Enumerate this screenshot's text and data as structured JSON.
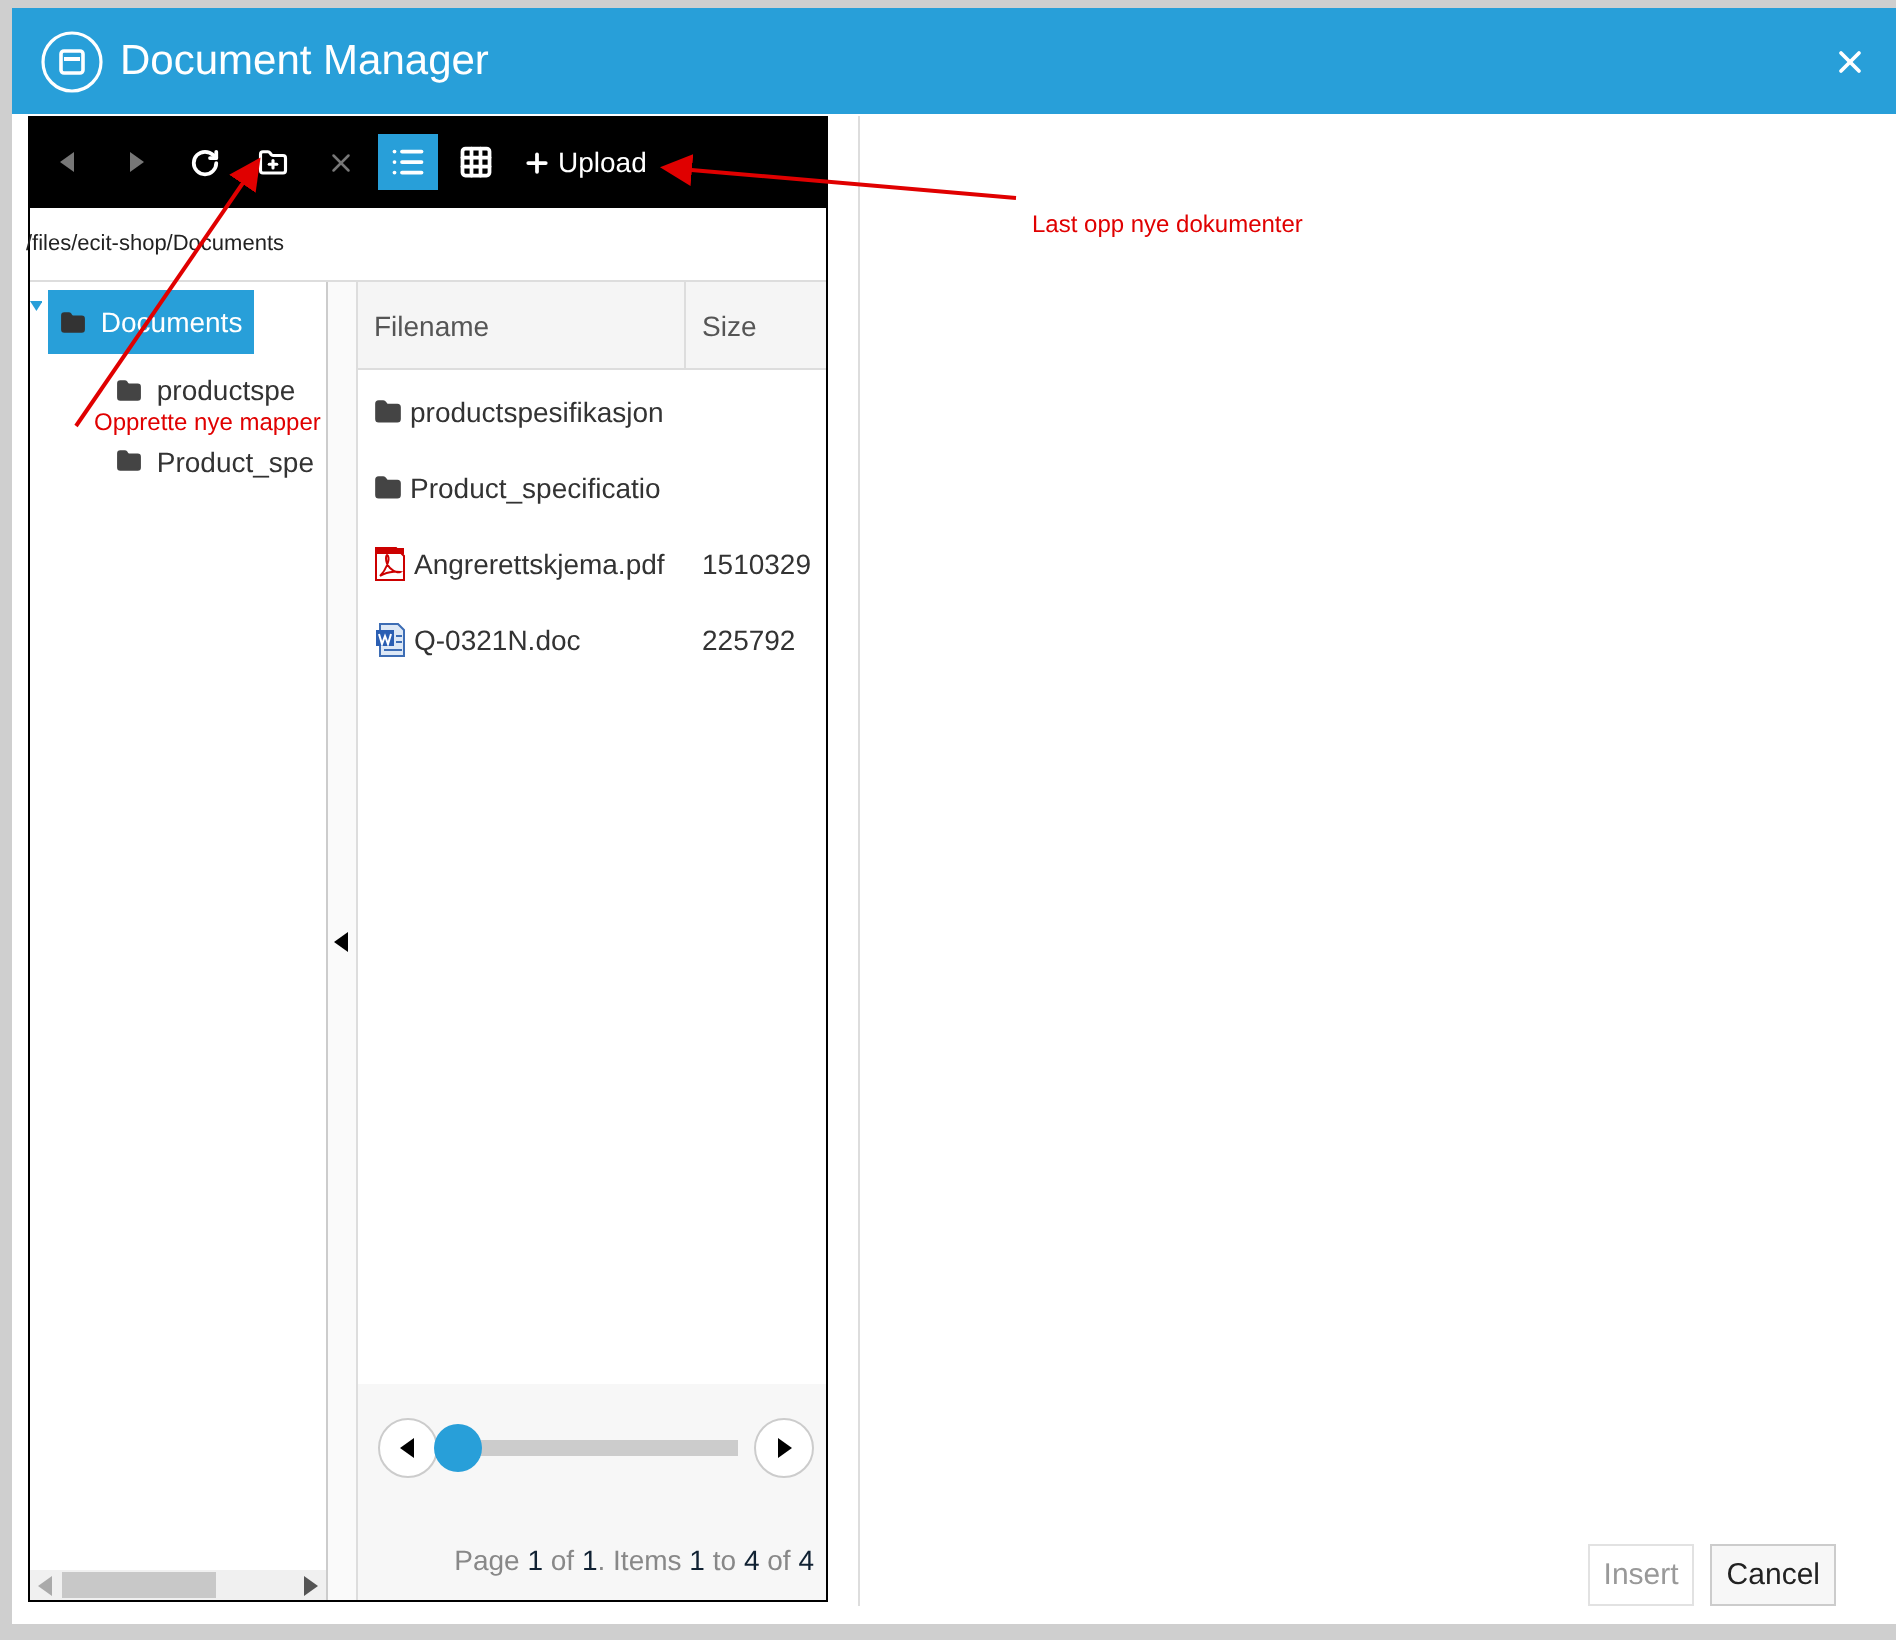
{
  "window": {
    "title": "Document Manager"
  },
  "toolbar": [
    {
      "kind": "back",
      "disabled": true,
      "selected": false
    },
    {
      "kind": "forward",
      "disabled": true,
      "selected": false
    },
    {
      "kind": "refresh",
      "disabled": false,
      "selected": false
    },
    {
      "kind": "new-folder",
      "disabled": false,
      "selected": false
    },
    {
      "kind": "delete",
      "disabled": true,
      "selected": false
    },
    {
      "kind": "list-view",
      "disabled": false,
      "selected": true
    },
    {
      "kind": "grid-view",
      "disabled": false,
      "selected": false
    },
    {
      "kind": "upload",
      "label": "Upload",
      "disabled": false,
      "selected": false
    }
  ],
  "path": "/files/ecit-shop/Documents",
  "tree": [
    {
      "label": "Documents",
      "selected": true,
      "expanded": true,
      "children": [
        {
          "label": "productspe",
          "selected": false
        },
        {
          "label": "Product_spe",
          "selected": false
        }
      ]
    }
  ],
  "table": {
    "columns": [
      "Filename",
      "Size"
    ],
    "rows": [
      {
        "kind": "folder",
        "name": "productspesifikasjon",
        "size": ""
      },
      {
        "kind": "folder",
        "name": "Product_specificatio",
        "size": ""
      },
      {
        "kind": "pdf",
        "name": "Angrerettskjema.pdf",
        "size": "1510329"
      },
      {
        "kind": "doc",
        "name": "Q-0321N.doc",
        "size": "225792"
      }
    ]
  },
  "pager": {
    "slider": {
      "level": 0
    },
    "summary": "Page **1** of **1**. Items **1** to **4** of **4**"
  },
  "buttons": [
    {
      "label": "Insert",
      "disabled": true
    },
    {
      "label": "Cancel",
      "disabled": false
    }
  ],
  "annotations": [
    {
      "text": "Last opp nye dokumenter"
    },
    {
      "text": "Opprette nye mapper"
    }
  ]
}
